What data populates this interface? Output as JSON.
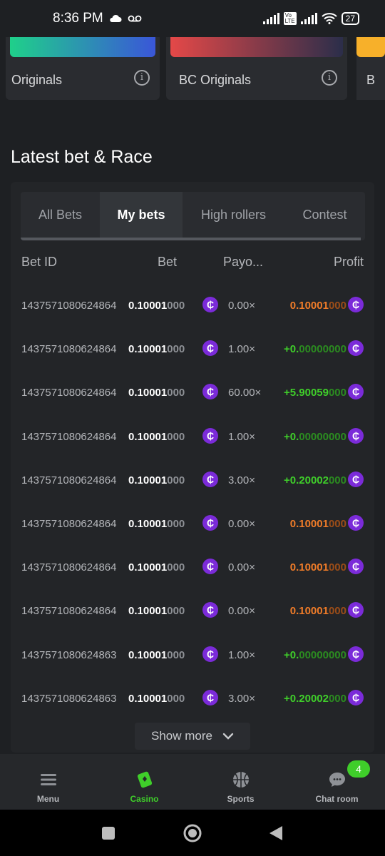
{
  "status_bar": {
    "time": "8:36 PM",
    "battery": "27"
  },
  "games": [
    {
      "label": "Originals",
      "gradient": [
        "#1fd08a",
        "#3a56d8"
      ]
    },
    {
      "label": "BC Originals",
      "gradient": [
        "#e44848",
        "#2b2e4a"
      ]
    },
    {
      "label": "B",
      "gradient": [
        "#f7b02a",
        "#f7b02a"
      ]
    }
  ],
  "section": {
    "title": "Latest bet & Race"
  },
  "tabs": [
    {
      "label": "All Bets",
      "active": false
    },
    {
      "label": "My bets",
      "active": true
    },
    {
      "label": "High rollers",
      "active": false
    },
    {
      "label": "Contest",
      "active": false
    }
  ],
  "table": {
    "headers": {
      "bet_id": "Bet ID",
      "bet": "Bet",
      "payout": "Payo...",
      "profit": "Profit"
    },
    "coin_symbol": "₵",
    "rows": [
      {
        "id": "1437571080624864",
        "bet_main": "0.10001",
        "bet_tail": "000",
        "payout": "0.00×",
        "profit_main": "0.10001",
        "profit_tail": "000",
        "result": "loss"
      },
      {
        "id": "1437571080624864",
        "bet_main": "0.10001",
        "bet_tail": "000",
        "payout": "1.00×",
        "profit_main": "+0.",
        "profit_tail": "00000000",
        "result": "win"
      },
      {
        "id": "1437571080624864",
        "bet_main": "0.10001",
        "bet_tail": "000",
        "payout": "60.00×",
        "profit_main": "+5.90059",
        "profit_tail": "000",
        "result": "win"
      },
      {
        "id": "1437571080624864",
        "bet_main": "0.10001",
        "bet_tail": "000",
        "payout": "1.00×",
        "profit_main": "+0.",
        "profit_tail": "00000000",
        "result": "win"
      },
      {
        "id": "1437571080624864",
        "bet_main": "0.10001",
        "bet_tail": "000",
        "payout": "3.00×",
        "profit_main": "+0.20002",
        "profit_tail": "000",
        "result": "win"
      },
      {
        "id": "1437571080624864",
        "bet_main": "0.10001",
        "bet_tail": "000",
        "payout": "0.00×",
        "profit_main": "0.10001",
        "profit_tail": "000",
        "result": "loss"
      },
      {
        "id": "1437571080624864",
        "bet_main": "0.10001",
        "bet_tail": "000",
        "payout": "0.00×",
        "profit_main": "0.10001",
        "profit_tail": "000",
        "result": "loss"
      },
      {
        "id": "1437571080624864",
        "bet_main": "0.10001",
        "bet_tail": "000",
        "payout": "0.00×",
        "profit_main": "0.10001",
        "profit_tail": "000",
        "result": "loss"
      },
      {
        "id": "1437571080624863",
        "bet_main": "0.10001",
        "bet_tail": "000",
        "payout": "1.00×",
        "profit_main": "+0.",
        "profit_tail": "00000000",
        "result": "win"
      },
      {
        "id": "1437571080624863",
        "bet_main": "0.10001",
        "bet_tail": "000",
        "payout": "3.00×",
        "profit_main": "+0.20002",
        "profit_tail": "000",
        "result": "win"
      }
    ]
  },
  "show_more": {
    "label": "Show more"
  },
  "bottom_nav": [
    {
      "label": "Menu",
      "icon": "menu-icon",
      "active": false
    },
    {
      "label": "Casino",
      "icon": "casino-icon",
      "active": true
    },
    {
      "label": "Sports",
      "icon": "basketball-icon",
      "active": false
    },
    {
      "label": "Chat room",
      "icon": "chat-icon",
      "active": false,
      "badge": "4"
    }
  ],
  "colors": {
    "background": "#1e2023",
    "panel": "#232528",
    "win": "#3fce2a",
    "loss": "#f07c28",
    "coin": "#7b2bd9"
  }
}
